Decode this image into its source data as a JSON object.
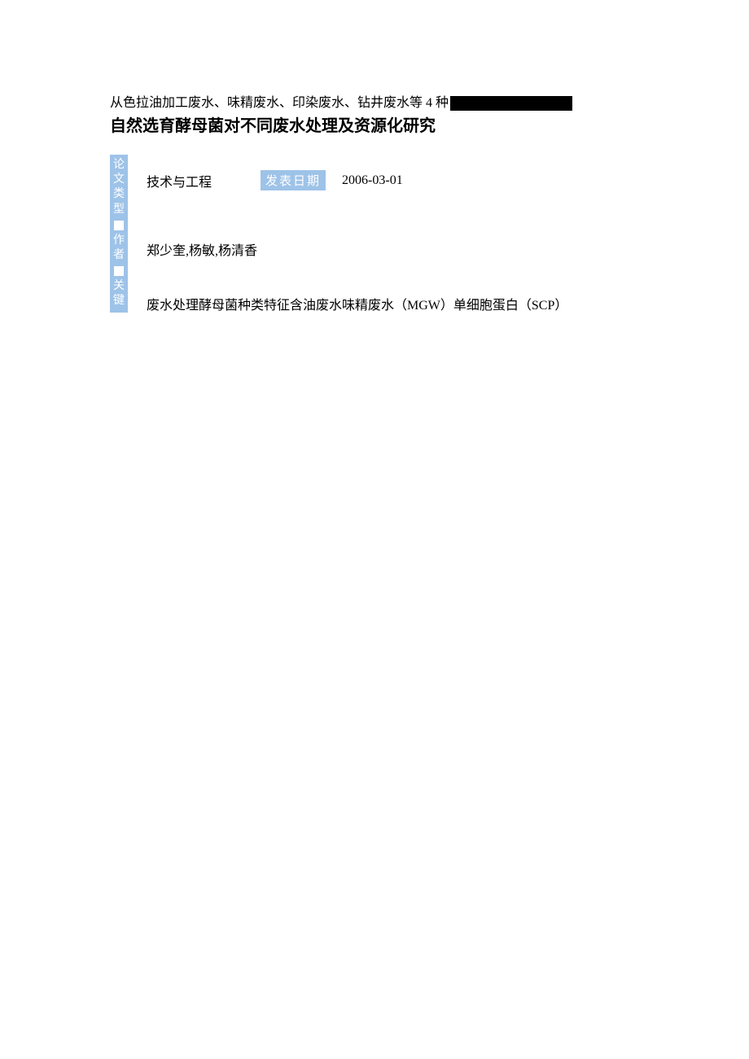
{
  "top_line": "从色拉油加工废水、味精废水、印染废水、钻井废水等 4 种",
  "title": "自然选育酵母菌对不同废水处理及资源化研究",
  "sidebar": {
    "section1": "论文类型",
    "section2": "作者",
    "section3": "关键"
  },
  "meta": {
    "type_value": "技术与工程",
    "date_label": "发表日期",
    "date_value": "2006-03-01"
  },
  "authors": "郑少奎,杨敏,杨清香",
  "keywords": "废水处理酵母菌种类特征含油废水味精废水（MGW）单细胞蛋白（SCP）"
}
